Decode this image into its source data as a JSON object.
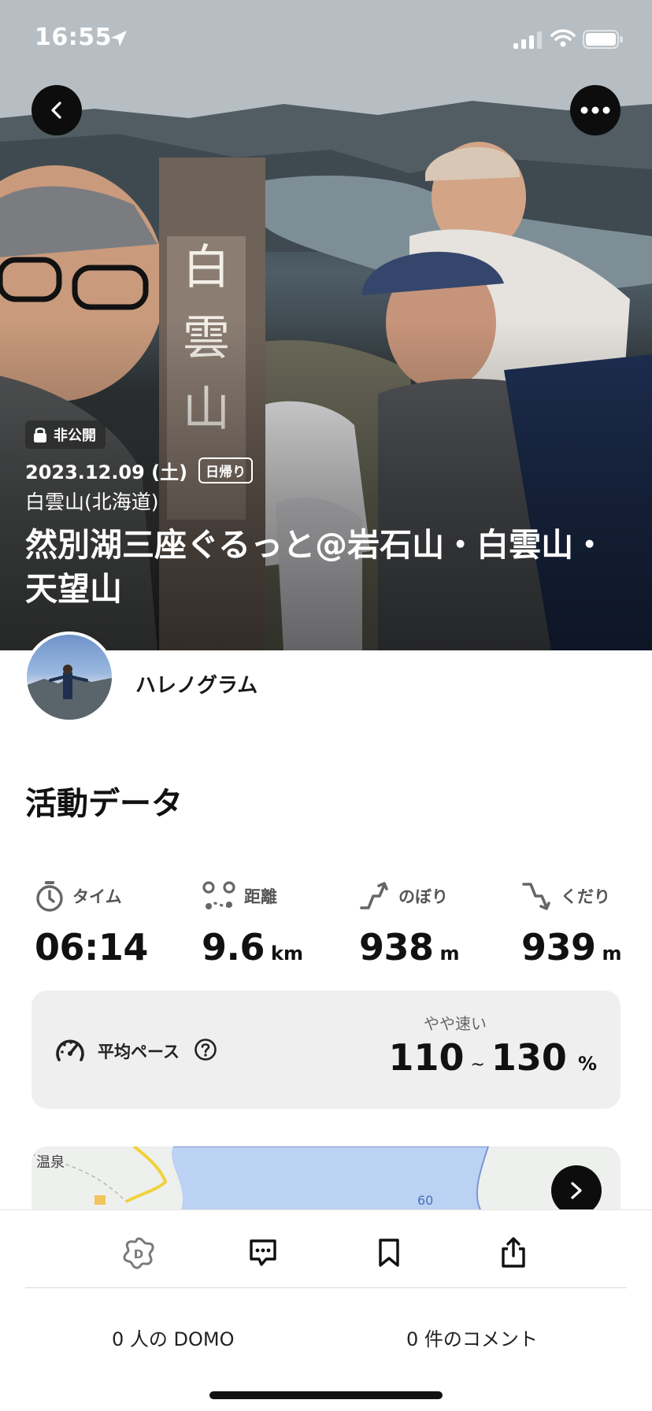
{
  "status_bar": {
    "time": "16:55"
  },
  "hero": {
    "privacy_badge": "非公開",
    "date": "2023.12.09 (土)",
    "trip_type": "日帰り",
    "mountain": "白雲山(北海道)",
    "title": "然別湖三座ぐるっと@岩石山・白雲山・天望山",
    "summit_sign": "白雲山"
  },
  "user": {
    "name": "ハレノグラム"
  },
  "activity": {
    "section_title": "活動データ",
    "stats": [
      {
        "label": "タイム",
        "value": "06:14",
        "unit": "",
        "icon": "stopwatch-icon"
      },
      {
        "label": "距離",
        "value": "9.6",
        "unit": "km",
        "icon": "route-icon"
      },
      {
        "label": "のぼり",
        "value": "938",
        "unit": "m",
        "icon": "ascent-icon"
      },
      {
        "label": "くだり",
        "value": "939",
        "unit": "m",
        "icon": "descent-icon"
      }
    ],
    "pace": {
      "label": "平均ペース",
      "speed_label": "やや速い",
      "min": "110",
      "tilde": "~",
      "max": "130",
      "unit": "%"
    }
  },
  "map": {
    "place_label": "温泉",
    "contour_label": "60"
  },
  "bottom_bar": {
    "domo_count": "0 人の DOMO",
    "comment_count": "0 件のコメント"
  },
  "colors": {
    "button_dark": "#0d0d0d",
    "card_bg": "#efefef",
    "lake_blue": "#bcd2f2",
    "route_yellow": "#f1d23a"
  }
}
